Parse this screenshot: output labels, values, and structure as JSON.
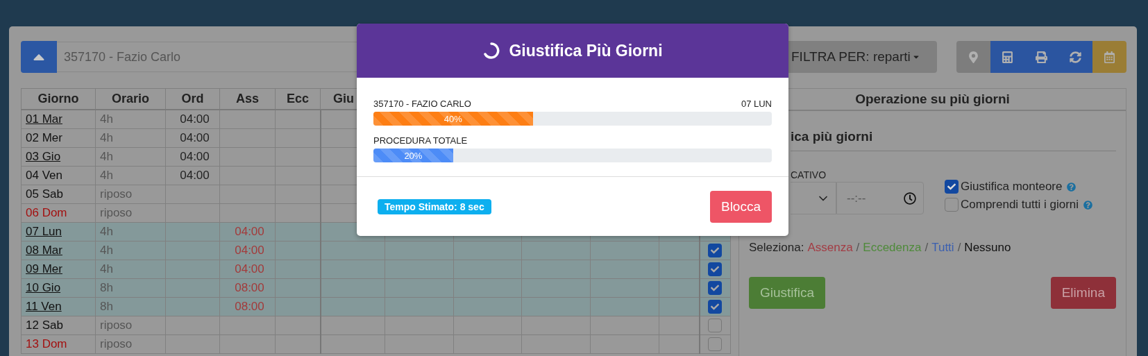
{
  "toolbar": {
    "employee": "357170 - Fazio Carlo",
    "filter": "FILTRA PER: reparti",
    "buttons": [
      {
        "kind": "pin",
        "color": "#7d7d7d"
      },
      {
        "kind": "calculator",
        "color": "#2b55a0"
      },
      {
        "kind": "print",
        "color": "#2b55a0"
      },
      {
        "kind": "refresh",
        "color": "#2b55a0"
      },
      {
        "kind": "calendar",
        "color": "#9a7d35"
      }
    ]
  },
  "table": {
    "columns": [
      "Giorno",
      "Orario",
      "Ord",
      "Ass",
      "Ecc",
      "Giu"
    ],
    "rows": [
      {
        "giorno": "01 Mar",
        "link": true,
        "festive": false,
        "orario": "4h",
        "ord": "04:00",
        "selected": false
      },
      {
        "giorno": "02 Mer",
        "link": false,
        "festive": false,
        "orario": "4h",
        "ord": "04:00",
        "selected": false
      },
      {
        "giorno": "03 Gio",
        "link": true,
        "festive": false,
        "orario": "4h",
        "ord": "04:00",
        "selected": false
      },
      {
        "giorno": "04 Ven",
        "link": false,
        "festive": false,
        "orario": "4h",
        "ord": "04:00",
        "selected": false
      },
      {
        "giorno": "05 Sab",
        "link": false,
        "festive": false,
        "orario": "riposo",
        "selected": false
      },
      {
        "giorno": "06 Dom",
        "link": false,
        "festive": true,
        "orario": "riposo",
        "selected": false
      },
      {
        "giorno": "07 Lun",
        "link": true,
        "festive": false,
        "orario": "4h",
        "ass": "04:00",
        "selected": true
      },
      {
        "giorno": "08 Mar",
        "link": true,
        "festive": false,
        "orario": "4h",
        "ass": "04:00",
        "selected": true,
        "checkbox": {
          "checked": true
        }
      },
      {
        "giorno": "09 Mer",
        "link": true,
        "festive": false,
        "orario": "4h",
        "ass": "04:00",
        "selected": true,
        "checkbox": {
          "checked": true
        }
      },
      {
        "giorno": "10 Gio",
        "link": true,
        "festive": false,
        "orario": "8h",
        "ass": "08:00",
        "selected": true,
        "checkbox": {
          "checked": true
        }
      },
      {
        "giorno": "11 Ven",
        "link": true,
        "festive": false,
        "orario": "8h",
        "ass": "08:00",
        "selected": true,
        "checkbox": {
          "checked": true
        }
      },
      {
        "giorno": "12 Sab",
        "link": false,
        "festive": false,
        "orario": "riposo",
        "selected": false,
        "checkbox": {
          "checked": false
        }
      },
      {
        "giorno": "13 Dom",
        "link": false,
        "festive": true,
        "orario": "riposo",
        "selected": false,
        "checkbox": {
          "checked": false
        }
      }
    ]
  },
  "panel": {
    "title": "Operazione su più giorni",
    "subtitle": "ica più giorni",
    "field_label": "CATIVO",
    "time_placeholder": "--:--",
    "options": [
      {
        "label": "Giustifica monteore",
        "checked": true
      },
      {
        "label": "Comprendi tutti i giorni",
        "checked": false
      }
    ],
    "select_label": "Seleziona:",
    "separators": [
      "/",
      "/",
      "/"
    ],
    "select_links": [
      {
        "label": "Assenza",
        "color": "#a33c44"
      },
      {
        "label": "Eccedenza",
        "color": "#4e8a3a"
      },
      {
        "label": "Tutti",
        "color": "#3a5fb0"
      },
      {
        "label": "Nessuno",
        "color": "#111111"
      }
    ],
    "justify_button": "Giustifica",
    "delete_button": "Elimina"
  },
  "modal": {
    "title": "Giustifica Più Giorni",
    "progress": [
      {
        "label": "357170 - FAZIO CARLO",
        "right": "07 LUN",
        "level": 0.4,
        "reading": "40%",
        "color": "#fd7e14"
      },
      {
        "label": "PROCEDURA TOTALE",
        "level": 0.2,
        "reading": "20%",
        "color": "#4d8cf7"
      }
    ],
    "estimate": "Tempo Stimato: 8 sec",
    "stop_button": "Blocca"
  }
}
